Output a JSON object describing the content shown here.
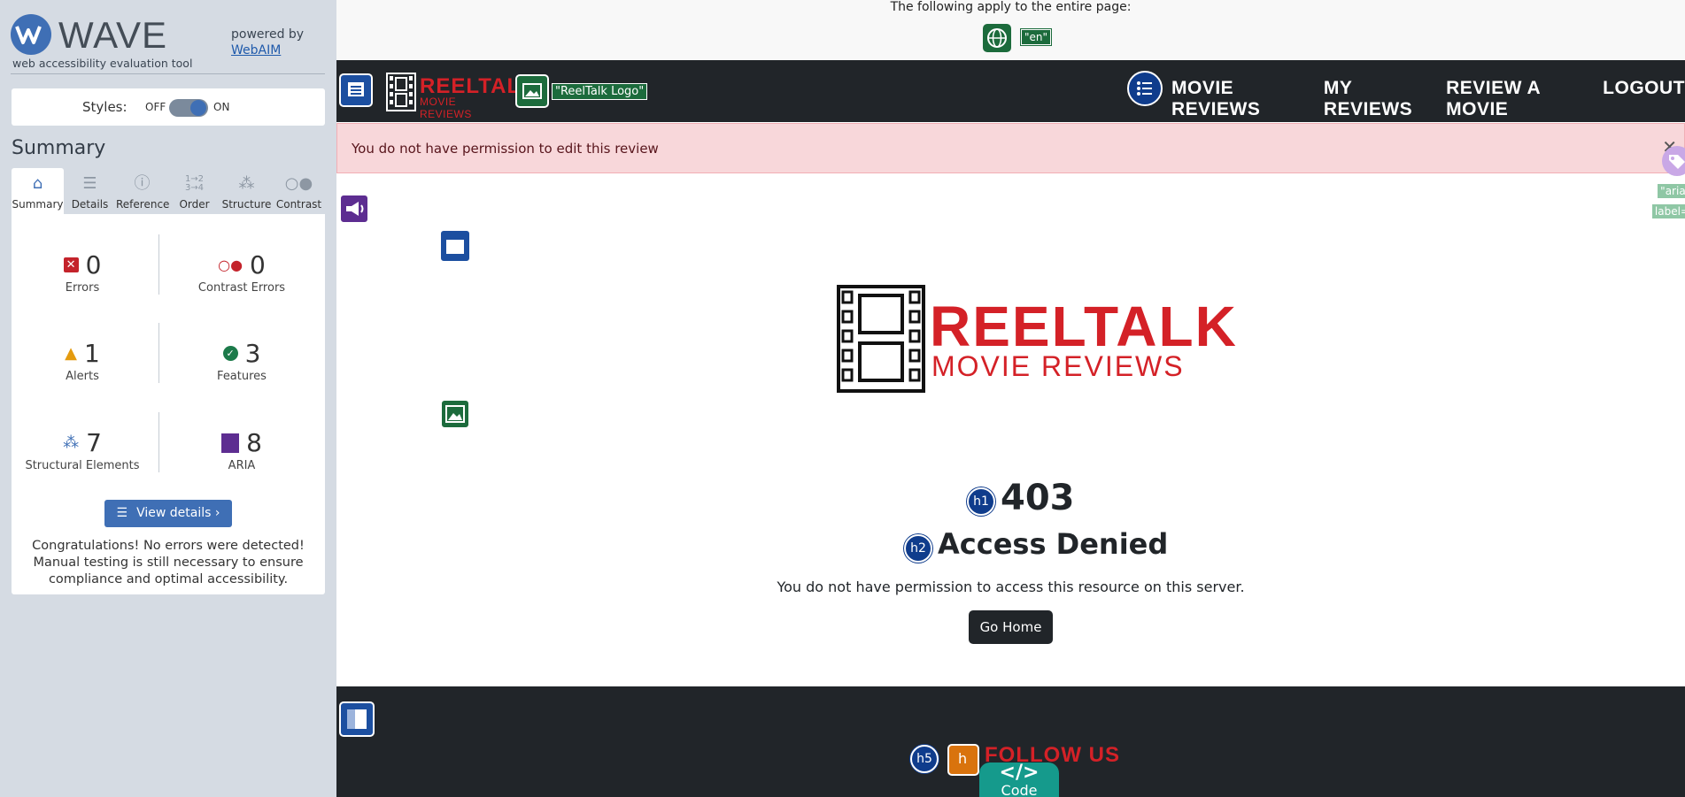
{
  "wave": {
    "name": "WAVE",
    "subtitle": "web accessibility evaluation tool",
    "powered_by": "powered by",
    "webaim": "WebAIM",
    "styles_label": "Styles:",
    "styles_off": "OFF",
    "styles_on": "ON",
    "summary_title": "Summary",
    "tabs": [
      {
        "label": "Summary",
        "icon": "home-icon"
      },
      {
        "label": "Details",
        "icon": "list-icon"
      },
      {
        "label": "Reference",
        "icon": "info-icon"
      },
      {
        "label": "Order",
        "icon": "order-icon"
      },
      {
        "label": "Structure",
        "icon": "structure-icon"
      },
      {
        "label": "Contrast",
        "icon": "contrast-icon"
      }
    ],
    "stats": {
      "errors": {
        "value": "0",
        "label": "Errors"
      },
      "contrast_errors": {
        "value": "0",
        "label": "Contrast Errors"
      },
      "alerts": {
        "value": "1",
        "label": "Alerts"
      },
      "features": {
        "value": "3",
        "label": "Features"
      },
      "structural": {
        "value": "7",
        "label": "Structural Elements"
      },
      "aria": {
        "value": "8",
        "label": "ARIA"
      }
    },
    "view_details": "View details ›",
    "congrats": "Congratulations! No errors were detected! Manual testing is still necessary to ensure compliance and optimal accessibility."
  },
  "page": {
    "apply_text": "The following apply to the entire page:",
    "lang_tag": "\"en\"",
    "brand_reel": "REELTALK",
    "brand_sub": "MOVIE REVIEWS",
    "logo_alt_tag": "\"ReelTalk Logo\"",
    "nav": [
      "MOVIE REVIEWS",
      "MY REVIEWS",
      "REVIEW A MOVIE",
      "LOGOUT"
    ],
    "alert_text": "You do not have permission to edit this review",
    "aria_tag_1": "\"aria-",
    "aria_tag_2": "label=",
    "logo_reel": "REELTALK",
    "logo_sub": "MOVIE REVIEWS",
    "h1_badge": "h1",
    "h1": "403",
    "h2_badge": "h2",
    "h2": "Access Denied",
    "message": "You do not have permission to access this resource on this server.",
    "go_home": "Go Home",
    "h5_badge": "h5",
    "follow_us": "FOLLOW US",
    "code_label": "Code",
    "code_symbol": "</>"
  },
  "colors": {
    "wave_blue": "#3f6fb5",
    "brand_red": "#d42127",
    "navbar": "#212529",
    "alert_bg": "#f8d7da",
    "feature_green": "#1c6b3c",
    "aria_purple": "#5d2d91",
    "code_teal": "#159a8c"
  }
}
